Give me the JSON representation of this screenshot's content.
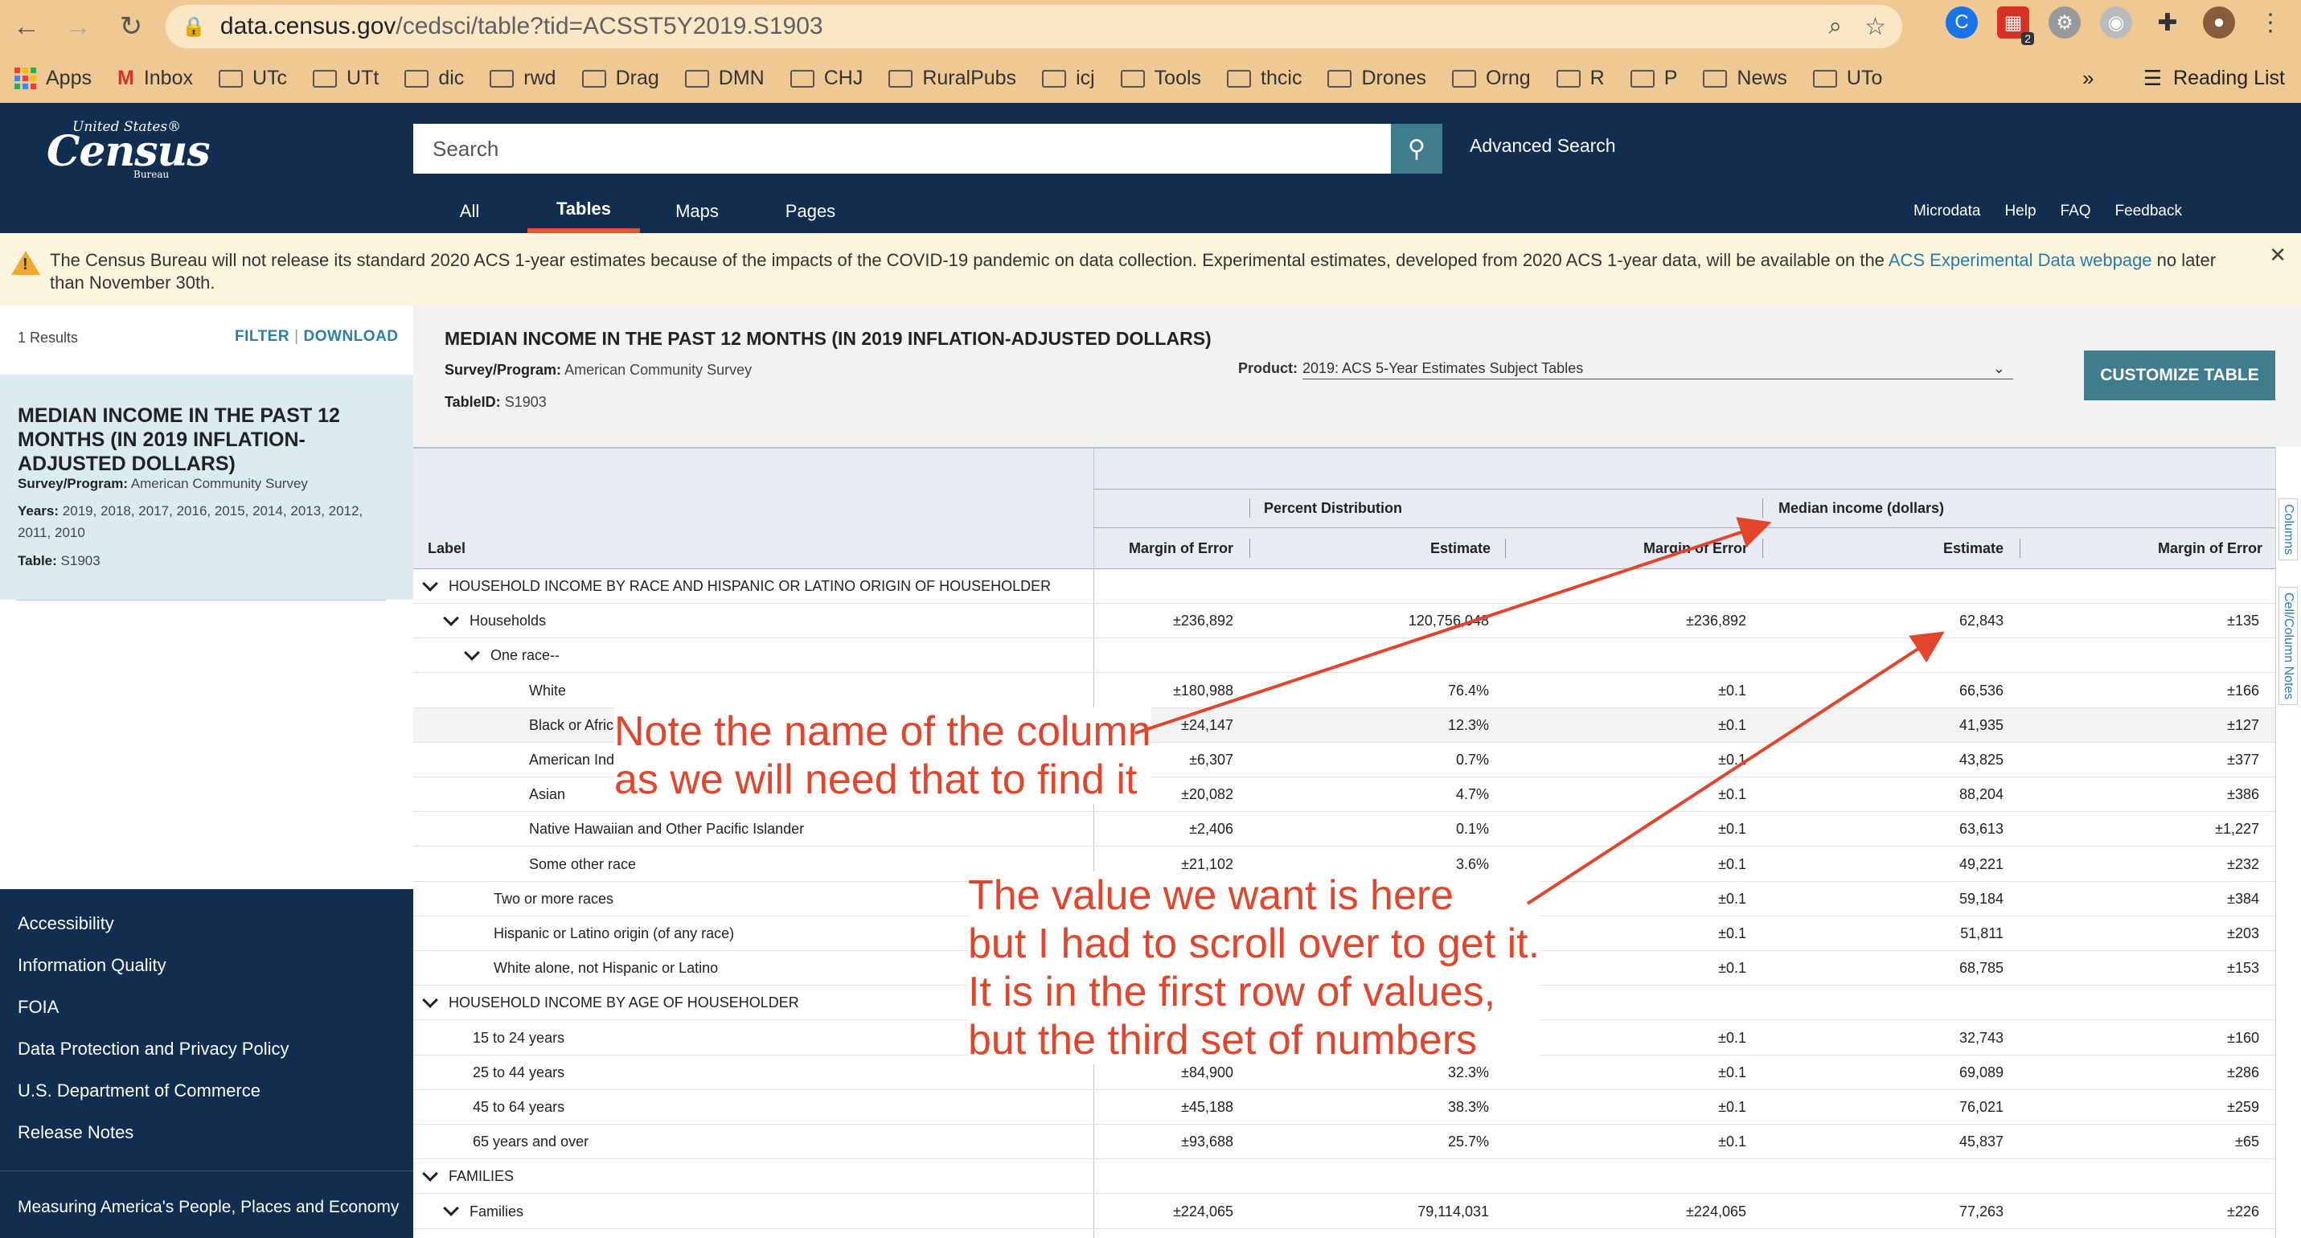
{
  "browser": {
    "url_domain": "data.census.gov",
    "url_path": "/cedsci/table?tid=ACSST5Y2019.S1903",
    "badge": "2",
    "bookmarks": [
      "Apps",
      "Inbox",
      "UTc",
      "UTt",
      "dic",
      "rwd",
      "Drag",
      "DMN",
      "CHJ",
      "RuralPubs",
      "icj",
      "Tools",
      "thcic",
      "Drones",
      "Orng",
      "R",
      "P",
      "News",
      "UTo"
    ],
    "overflow": "»",
    "reading_list": "Reading List"
  },
  "header": {
    "logo_top": "United States®",
    "logo_main": "Census",
    "logo_bottom": "Bureau",
    "search_placeholder": "Search",
    "advanced_search": "Advanced Search",
    "tabs": [
      "All",
      "Tables",
      "Maps",
      "Pages"
    ],
    "right_links": [
      "Microdata",
      "Help",
      "FAQ",
      "Feedback"
    ]
  },
  "alert": {
    "text": "The Census Bureau will not release its standard 2020 ACS 1-year estimates because of the impacts of the COVID-19 pandemic on data collection. Experimental estimates, developed from 2020 ACS 1-year data, will be available on the ",
    "link": "ACS Experimental Data webpage",
    "tail": " no later than November 30th."
  },
  "left": {
    "results": "1 Results",
    "filter": "FILTER",
    "download": "DOWNLOAD",
    "card_title": "MEDIAN INCOME IN THE PAST 12 MONTHS (IN 2019 INFLATION-ADJUSTED DOLLARS)",
    "survey_label": "Survey/Program:",
    "survey_value": "American Community Survey",
    "years_label": "Years:",
    "years_value": "2019, 2018, 2017, 2016, 2015, 2014, 2013, 2012, 2011, 2010",
    "table_label": "Table:",
    "table_value": "S1903",
    "footer": [
      "Accessibility",
      "Information Quality",
      "FOIA",
      "Data Protection and Privacy Policy",
      "U.S. Department of Commerce",
      "Release Notes",
      "Measuring America's People, Places and Economy"
    ]
  },
  "main": {
    "title": "MEDIAN INCOME IN THE PAST 12 MONTHS (IN 2019 INFLATION-ADJUSTED DOLLARS)",
    "survey_label": "Survey/Program:",
    "survey_value": "American Community Survey",
    "tableid_label": "TableID:",
    "tableid_value": "S1903",
    "product_label": "Product:",
    "product_value": "2019: ACS 5-Year Estimates Subject Tables",
    "customize": "CUSTOMIZE TABLE",
    "side_tabs": [
      "Columns",
      "Cell/Column Notes"
    ]
  },
  "table": {
    "group_headers": [
      "Percent Distribution",
      "Median income (dollars)"
    ],
    "columns": [
      "Label",
      "Margin of Error",
      "Estimate",
      "Margin of Error",
      "Estimate",
      "Margin of Error"
    ],
    "rows": [
      {
        "label": "HOUSEHOLD INCOME BY RACE AND HISPANIC OR LATINO ORIGIN OF HOUSEHOLDER",
        "indent": 0,
        "chev": true,
        "v": [
          "",
          "",
          "",
          "",
          ""
        ]
      },
      {
        "label": "Households",
        "indent": 1,
        "chev": true,
        "v": [
          "±236,892",
          "120,756,048",
          "±236,892",
          "62,843",
          "±135"
        ]
      },
      {
        "label": "One race--",
        "indent": 2,
        "chev": true,
        "v": [
          "",
          "",
          "",
          "",
          ""
        ]
      },
      {
        "label": "White",
        "indent": 3,
        "chev": false,
        "v": [
          "±180,988",
          "76.4%",
          "±0.1",
          "66,536",
          "±166"
        ]
      },
      {
        "label": "Black or African American",
        "indent": 3,
        "chev": false,
        "v": [
          "±24,147",
          "12.3%",
          "±0.1",
          "41,935",
          "±127"
        ]
      },
      {
        "label": "American Indian and Alaska Native",
        "indent": 3,
        "chev": false,
        "v": [
          "±6,307",
          "0.7%",
          "±0.1",
          "43,825",
          "±377"
        ]
      },
      {
        "label": "Asian",
        "indent": 3,
        "chev": false,
        "v": [
          "±20,082",
          "4.7%",
          "±0.1",
          "88,204",
          "±386"
        ]
      },
      {
        "label": "Native Hawaiian and Other Pacific Islander",
        "indent": 3,
        "chev": false,
        "v": [
          "±2,406",
          "0.1%",
          "±0.1",
          "63,613",
          "±1,227"
        ]
      },
      {
        "label": "Some other race",
        "indent": 3,
        "chev": false,
        "v": [
          "±21,102",
          "3.6%",
          "±0.1",
          "49,221",
          "±232"
        ]
      },
      {
        "label": "Two or more races",
        "indent": 2,
        "chev": false,
        "v": [
          "",
          "",
          "±0.1",
          "59,184",
          "±384"
        ]
      },
      {
        "label": "Hispanic or Latino origin (of any race)",
        "indent": 2,
        "chev": false,
        "v": [
          "",
          "",
          "±0.1",
          "51,811",
          "±203"
        ]
      },
      {
        "label": "White alone, not Hispanic or Latino",
        "indent": 2,
        "chev": false,
        "v": [
          "",
          "",
          "±0.1",
          "68,785",
          "±153"
        ]
      },
      {
        "label": "HOUSEHOLD INCOME BY AGE OF HOUSEHOLDER",
        "indent": 0,
        "chev": true,
        "v": [
          "",
          "",
          "",
          "",
          ""
        ]
      },
      {
        "label": "15 to 24 years",
        "indent": 1,
        "chev": false,
        "v": [
          "",
          "",
          "±0.1",
          "32,743",
          "±160"
        ]
      },
      {
        "label": "25 to 44 years",
        "indent": 1,
        "chev": false,
        "v": [
          "±84,900",
          "32.3%",
          "±0.1",
          "69,089",
          "±286"
        ]
      },
      {
        "label": "45 to 64 years",
        "indent": 1,
        "chev": false,
        "v": [
          "±45,188",
          "38.3%",
          "±0.1",
          "76,021",
          "±259"
        ]
      },
      {
        "label": "65 years and over",
        "indent": 1,
        "chev": false,
        "v": [
          "±93,688",
          "25.7%",
          "±0.1",
          "45,837",
          "±65"
        ]
      },
      {
        "label": "FAMILIES",
        "indent": 0,
        "chev": true,
        "v": [
          "",
          "",
          "",
          "",
          ""
        ]
      },
      {
        "label": "Families",
        "indent": 1,
        "chev": true,
        "v": [
          "±224,065",
          "79,114,031",
          "±224,065",
          "77,263",
          "±226"
        ]
      }
    ]
  },
  "annotations": {
    "note1": [
      "Note the name of the column",
      "as we will need that to find it"
    ],
    "note2": [
      "The value we want is here",
      "but I had to scroll over to get it.",
      "It is in the first row of values,",
      "but the third set of numbers"
    ],
    "color": "#e2452c"
  }
}
